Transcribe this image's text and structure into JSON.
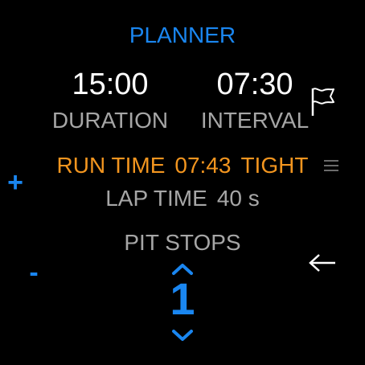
{
  "header": {
    "title": "PLANNER"
  },
  "duration": {
    "value": "15:00",
    "label": "DURATION"
  },
  "interval": {
    "value": "07:30",
    "label": "INTERVAL"
  },
  "run": {
    "label": "RUN TIME",
    "value": "07:43",
    "status": "TIGHT"
  },
  "lap": {
    "label": "LAP TIME",
    "value": "40 s"
  },
  "pit_stops": {
    "label": "PIT STOPS",
    "value": "1"
  },
  "controls": {
    "increment_symbol": "+",
    "decrement_symbol": "-"
  },
  "icons": {
    "flag": "flag-icon",
    "menu": "menu-icon",
    "back": "back-arrow-icon",
    "up": "chevron-up-icon",
    "down": "chevron-down-icon"
  },
  "colors": {
    "accent": "#1a86f0",
    "warning": "#f2951f",
    "muted": "#a6a6a6",
    "background": "#000000"
  }
}
